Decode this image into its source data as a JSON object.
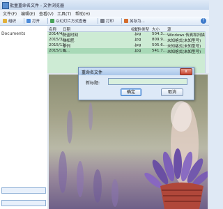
{
  "window": {
    "title": "批量重命名文件 - 文件浏览器"
  },
  "menu": {
    "items": [
      "文件(F)",
      "编辑(E)",
      "查看(V)",
      "工具(T)",
      "帮助(H)"
    ]
  },
  "toolbar": {
    "buttons": [
      {
        "label": "组织",
        "icon": "organize-icon",
        "color": "#e2b13c"
      },
      {
        "label": "打开",
        "icon": "open-icon",
        "color": "#4c8ad8"
      },
      {
        "label": "以幻灯片方式查看",
        "icon": "slideshow-icon",
        "color": "#4aa35a"
      },
      {
        "label": "打印",
        "icon": "print-icon",
        "color": "#7a7f8a"
      },
      {
        "label": "另存为...",
        "icon": "save-as-icon",
        "color": "#d46b2c"
      }
    ],
    "help_label": "?"
  },
  "left_pane": {
    "item_label": "Documents"
  },
  "file_list": {
    "columns": [
      "名称",
      "日期",
      "标记",
      "文件类型",
      "大小",
      "源"
    ],
    "rows": [
      {
        "name": "",
        "date": "2014/4/...",
        "tag": "防盗时刻",
        "type": ".jpg",
        "size": "504.3...",
        "source": "Windows 传真和扫描(未...",
        "selected": false
      },
      {
        "name": "",
        "date": "2015/3/...",
        "tag": "梯松肥",
        "type": ".jpg",
        "size": "809.9...",
        "source": "未知格式(未知型号)",
        "selected": false
      },
      {
        "name": "",
        "date": "2015/12/...",
        "tag": "系列",
        "type": ".jpg",
        "size": "505.6...",
        "source": "未知格式(未知型号)",
        "selected": false
      },
      {
        "name": "",
        "date": "2015/11/...",
        "tag": "dj",
        "type": ".jpg",
        "size": "541.7...",
        "source": "未知格式(未知型号)",
        "selected": true
      }
    ]
  },
  "dialog": {
    "title": "重命名文件",
    "label": "新标题:",
    "input_value": "",
    "ok_label": "确定",
    "cancel_label": "取消",
    "close_label": "x"
  },
  "colors": {
    "accent": "#3a78c9",
    "list_bg": "#cdebd4",
    "selection": "#a8d9b7"
  }
}
